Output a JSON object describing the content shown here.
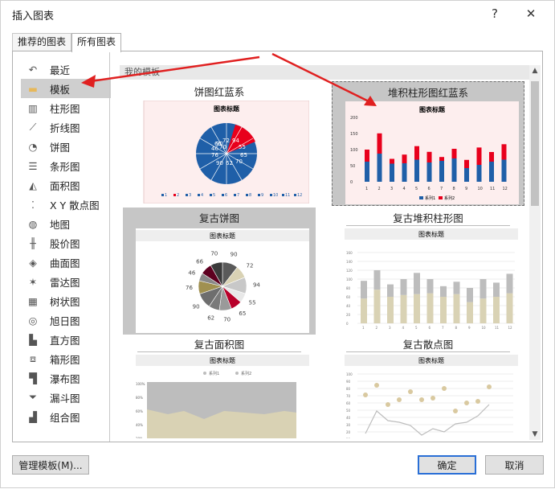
{
  "dialog": {
    "title": "插入图表",
    "help": "?",
    "close": "✕"
  },
  "tabs": [
    {
      "label": "推荐的图表"
    },
    {
      "label": "所有图表"
    }
  ],
  "sidebar": {
    "items": [
      {
        "label": "最近",
        "icon": "recent-icon"
      },
      {
        "label": "模板",
        "icon": "folder-icon"
      },
      {
        "label": "柱形图",
        "icon": "column-chart-icon"
      },
      {
        "label": "折线图",
        "icon": "line-chart-icon"
      },
      {
        "label": "饼图",
        "icon": "pie-chart-icon"
      },
      {
        "label": "条形图",
        "icon": "bar-chart-icon"
      },
      {
        "label": "面积图",
        "icon": "area-chart-icon"
      },
      {
        "label": "X Y 散点图",
        "icon": "scatter-chart-icon"
      },
      {
        "label": "地图",
        "icon": "map-chart-icon"
      },
      {
        "label": "股价图",
        "icon": "stock-chart-icon"
      },
      {
        "label": "曲面图",
        "icon": "surface-chart-icon"
      },
      {
        "label": "雷达图",
        "icon": "radar-chart-icon"
      },
      {
        "label": "树状图",
        "icon": "treemap-chart-icon"
      },
      {
        "label": "旭日图",
        "icon": "sunburst-chart-icon"
      },
      {
        "label": "直方图",
        "icon": "histogram-chart-icon"
      },
      {
        "label": "箱形图",
        "icon": "box-chart-icon"
      },
      {
        "label": "瀑布图",
        "icon": "waterfall-chart-icon"
      },
      {
        "label": "漏斗图",
        "icon": "funnel-chart-icon"
      },
      {
        "label": "组合图",
        "icon": "combo-chart-icon"
      }
    ]
  },
  "gallery": {
    "section_title": "我的模板",
    "templates": [
      {
        "title": "饼图红蓝系",
        "chart_title": "图表标题"
      },
      {
        "title": "堆积柱形图红蓝系",
        "chart_title": "图表标题"
      },
      {
        "title": "复古饼图",
        "chart_title": "图表标题"
      },
      {
        "title": "复古堆积柱形图",
        "chart_title": "图表标题"
      },
      {
        "title": "复古面积图",
        "chart_title": "图表标题"
      },
      {
        "title": "复古散点图",
        "chart_title": "图表标题"
      }
    ]
  },
  "pie_labels": [
    "90",
    "72",
    "94",
    "55",
    "65",
    "70",
    "62",
    "90",
    "76",
    "46",
    "66",
    "70"
  ],
  "legend": {
    "series1": "系列1",
    "series2": "系列2",
    "pie_items": [
      "1",
      "2",
      "3",
      "4",
      "5",
      "6",
      "7",
      "8",
      "9",
      "10",
      "11",
      "12"
    ]
  },
  "footer": {
    "manage_label": "管理模板(M)...",
    "ok_label": "确定",
    "cancel_label": "取消"
  },
  "colors": {
    "red": "#e8001c",
    "blue": "#1f5fa8",
    "pink": "#fdeeee",
    "khaki": "#d9d2b4",
    "grey": "#bdbdbd",
    "arrow": "#e02020"
  }
}
